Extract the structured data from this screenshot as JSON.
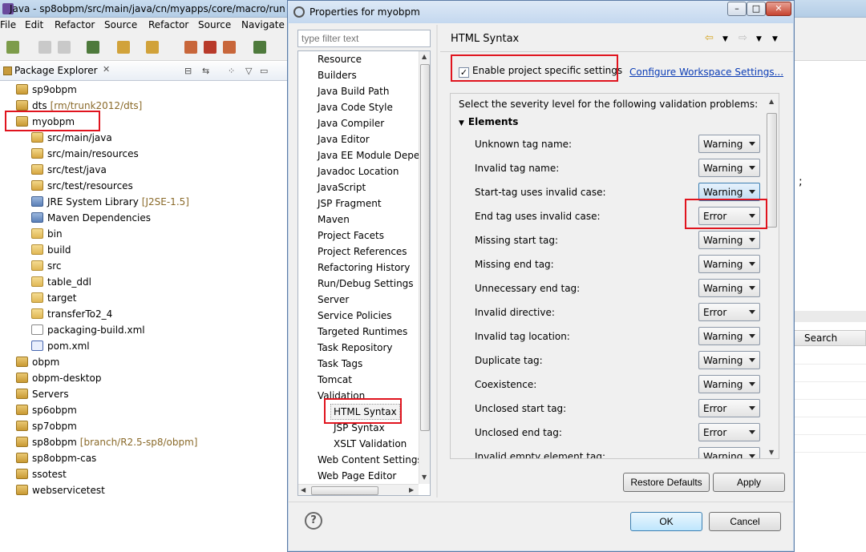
{
  "window": {
    "title": "Java - sp8obpm/src/main/java/cn/myapps/core/macro/run"
  },
  "menubar": [
    "File",
    "Edit",
    "Refactor",
    "Source",
    "Refactor",
    "Source",
    "Navigate"
  ],
  "package_explorer": {
    "title": "Package Explorer",
    "close_glyph": "✕",
    "items": [
      {
        "label": "sp9obpm",
        "decoration": "",
        "icon": "project-icon",
        "indent": 1
      },
      {
        "label": "dts",
        "decoration": "[rm/trunk2012/dts]",
        "icon": "project-icon",
        "indent": 1
      },
      {
        "label": "myobpm",
        "decoration": "",
        "icon": "maven-project-icon",
        "indent": 1
      },
      {
        "label": "src/main/java",
        "decoration": "",
        "icon": "source-folder-icon",
        "indent": 2
      },
      {
        "label": "src/main/resources",
        "decoration": "",
        "icon": "source-folder-icon",
        "indent": 2
      },
      {
        "label": "src/test/java",
        "decoration": "",
        "icon": "source-folder-icon",
        "indent": 2
      },
      {
        "label": "src/test/resources",
        "decoration": "",
        "icon": "source-folder-icon",
        "indent": 2
      },
      {
        "label": "JRE System Library",
        "decoration": "[J2SE-1.5]",
        "icon": "library-icon",
        "indent": 2
      },
      {
        "label": "Maven Dependencies",
        "decoration": "",
        "icon": "library-icon",
        "indent": 2
      },
      {
        "label": "bin",
        "decoration": "",
        "icon": "folder-icon",
        "indent": 2
      },
      {
        "label": "build",
        "decoration": "",
        "icon": "folder-icon",
        "indent": 2
      },
      {
        "label": "src",
        "decoration": "",
        "icon": "folder-icon",
        "indent": 2
      },
      {
        "label": "table_ddl",
        "decoration": "",
        "icon": "folder-icon",
        "indent": 2
      },
      {
        "label": "target",
        "decoration": "",
        "icon": "folder-icon",
        "indent": 2
      },
      {
        "label": "transferTo2_4",
        "decoration": "",
        "icon": "folder-icon",
        "indent": 2
      },
      {
        "label": "packaging-build.xml",
        "decoration": "",
        "icon": "xml-file-icon",
        "indent": 2
      },
      {
        "label": "pom.xml",
        "decoration": "",
        "icon": "pom-file-icon",
        "indent": 2
      },
      {
        "label": "obpm",
        "decoration": "",
        "icon": "project-icon",
        "indent": 1
      },
      {
        "label": "obpm-desktop",
        "decoration": "",
        "icon": "project-icon",
        "indent": 1
      },
      {
        "label": "Servers",
        "decoration": "",
        "icon": "project-icon",
        "indent": 1
      },
      {
        "label": "sp6obpm",
        "decoration": "",
        "icon": "project-icon",
        "indent": 1
      },
      {
        "label": "sp7obpm",
        "decoration": "",
        "icon": "project-icon",
        "indent": 1
      },
      {
        "label": "sp8obpm",
        "decoration": "[branch/R2.5-sp8/obpm]",
        "icon": "maven-project-icon",
        "indent": 1
      },
      {
        "label": "sp8obpm-cas",
        "decoration": "",
        "icon": "project-icon",
        "indent": 1
      },
      {
        "label": "ssotest",
        "decoration": "",
        "icon": "project-icon",
        "indent": 1
      },
      {
        "label": "webservicetest",
        "decoration": "",
        "icon": "project-icon",
        "indent": 1
      }
    ]
  },
  "background_right": {
    "semicolon": ";",
    "search_tab": "Search"
  },
  "dialog": {
    "title": "Properties for myobpm",
    "window_buttons": [
      "–",
      "□",
      "✕"
    ],
    "filter_placeholder": "type filter text",
    "nav_items": [
      {
        "label": "Resource",
        "sub": false
      },
      {
        "label": "Builders",
        "sub": false
      },
      {
        "label": "Java Build Path",
        "sub": false
      },
      {
        "label": "Java Code Style",
        "sub": false
      },
      {
        "label": "Java Compiler",
        "sub": false
      },
      {
        "label": "Java Editor",
        "sub": false
      },
      {
        "label": "Java EE Module Depe",
        "sub": false
      },
      {
        "label": "Javadoc Location",
        "sub": false
      },
      {
        "label": "JavaScript",
        "sub": false
      },
      {
        "label": "JSP Fragment",
        "sub": false
      },
      {
        "label": "Maven",
        "sub": false
      },
      {
        "label": "Project Facets",
        "sub": false
      },
      {
        "label": "Project References",
        "sub": false
      },
      {
        "label": "Refactoring History",
        "sub": false
      },
      {
        "label": "Run/Debug Settings",
        "sub": false
      },
      {
        "label": "Server",
        "sub": false
      },
      {
        "label": "Service Policies",
        "sub": false
      },
      {
        "label": "Targeted Runtimes",
        "sub": false
      },
      {
        "label": "Task Repository",
        "sub": false
      },
      {
        "label": "Task Tags",
        "sub": false
      },
      {
        "label": "Tomcat",
        "sub": false
      },
      {
        "label": "Validation",
        "sub": false
      },
      {
        "label": "HTML Syntax",
        "sub": true
      },
      {
        "label": "JSP Syntax",
        "sub": true
      },
      {
        "label": "XSLT Validation",
        "sub": true
      },
      {
        "label": "Web Content Settings",
        "sub": false
      },
      {
        "label": "Web Page Editor",
        "sub": false
      }
    ],
    "selected_nav": "HTML Syntax",
    "page": {
      "title": "HTML Syntax",
      "enable_label": "Enable project specific settings",
      "enable_checked": true,
      "configure_link": "Configure Workspace Settings...",
      "description": "Select the severity level for the following validation problems:",
      "section_title": "Elements",
      "rules": [
        {
          "label": "Unknown tag name:",
          "value": "Warning",
          "active": false
        },
        {
          "label": "Invalid tag name:",
          "value": "Warning",
          "active": false
        },
        {
          "label": "Start-tag uses invalid case:",
          "value": "Warning",
          "active": true
        },
        {
          "label": "End tag uses invalid case:",
          "value": "Error",
          "active": false
        },
        {
          "label": "Missing start tag:",
          "value": "Warning",
          "active": false
        },
        {
          "label": "Missing end tag:",
          "value": "Warning",
          "active": false
        },
        {
          "label": "Unnecessary end tag:",
          "value": "Warning",
          "active": false
        },
        {
          "label": "Invalid directive:",
          "value": "Error",
          "active": false
        },
        {
          "label": "Invalid tag location:",
          "value": "Warning",
          "active": false
        },
        {
          "label": "Duplicate tag:",
          "value": "Warning",
          "active": false
        },
        {
          "label": "Coexistence:",
          "value": "Warning",
          "active": false
        },
        {
          "label": "Unclosed start tag:",
          "value": "Error",
          "active": false
        },
        {
          "label": "Unclosed end tag:",
          "value": "Error",
          "active": false
        },
        {
          "label": "Invalid empty element tag:",
          "value": "Warning",
          "active": false
        }
      ],
      "restore_defaults": "Restore Defaults",
      "apply": "Apply"
    },
    "ok": "OK",
    "cancel": "Cancel",
    "help_glyph": "?"
  },
  "colors": {
    "highlight": "#e0141e",
    "link": "#0b3cb5"
  }
}
